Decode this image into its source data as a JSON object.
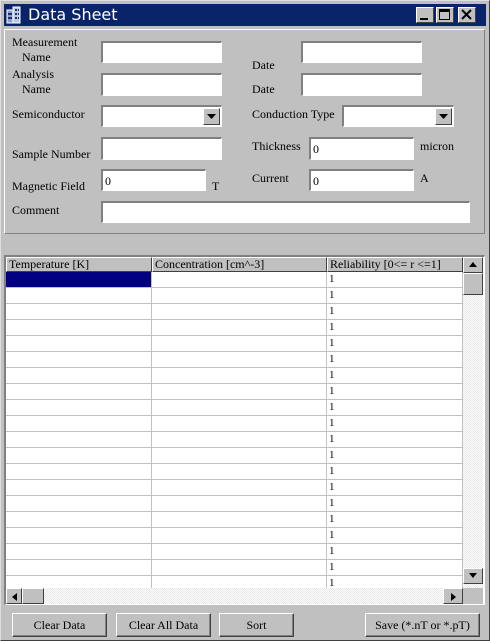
{
  "window": {
    "title": "Data Sheet",
    "accent_color": "#0a246a",
    "controls": [
      "minimize-icon",
      "maximize-icon",
      "close-icon"
    ]
  },
  "form": {
    "measurement_name_label_line1": "Measurement",
    "measurement_name_label_line2": "Name",
    "measurement_name_value": "",
    "measurement_date_label": "Date",
    "measurement_date_value": "",
    "analysis_name_label_line1": "Analysis",
    "analysis_name_label_line2": "Name",
    "analysis_name_value": "",
    "analysis_date_label": "Date",
    "analysis_date_value": "",
    "semiconductor_label": "Semiconductor",
    "semiconductor_value": "",
    "conduction_type_label": "Conduction Type",
    "conduction_type_value": "",
    "sample_number_label": "Sample Number",
    "sample_number_value": "",
    "thickness_label": "Thickness",
    "thickness_value": "0",
    "thickness_unit": "micron",
    "magnetic_field_label": "Magnetic Field",
    "magnetic_field_value": "0",
    "magnetic_field_unit": "T",
    "current_label": "Current",
    "current_value": "0",
    "current_unit": "A",
    "comment_label": "Comment",
    "comment_value": ""
  },
  "grid": {
    "columns": [
      "Temperature [K]",
      "Concentration [cm^-3]",
      "Reliability [0<= r <=1]"
    ],
    "rows": [
      [
        "",
        "",
        "1"
      ],
      [
        "",
        "",
        "1"
      ],
      [
        "",
        "",
        "1"
      ],
      [
        "",
        "",
        "1"
      ],
      [
        "",
        "",
        "1"
      ],
      [
        "",
        "",
        "1"
      ],
      [
        "",
        "",
        "1"
      ],
      [
        "",
        "",
        "1"
      ],
      [
        "",
        "",
        "1"
      ],
      [
        "",
        "",
        "1"
      ],
      [
        "",
        "",
        "1"
      ],
      [
        "",
        "",
        "1"
      ],
      [
        "",
        "",
        "1"
      ],
      [
        "",
        "",
        "1"
      ],
      [
        "",
        "",
        "1"
      ],
      [
        "",
        "",
        "1"
      ],
      [
        "",
        "",
        "1"
      ],
      [
        "",
        "",
        "1"
      ],
      [
        "",
        "",
        "1"
      ],
      [
        "",
        "",
        "1"
      ]
    ],
    "selection_color": "#000080"
  },
  "buttons": {
    "clear_data": "Clear Data",
    "clear_all_data": "Clear All Data",
    "sort": "Sort",
    "save": "Save (*.nT or *.pT)"
  }
}
